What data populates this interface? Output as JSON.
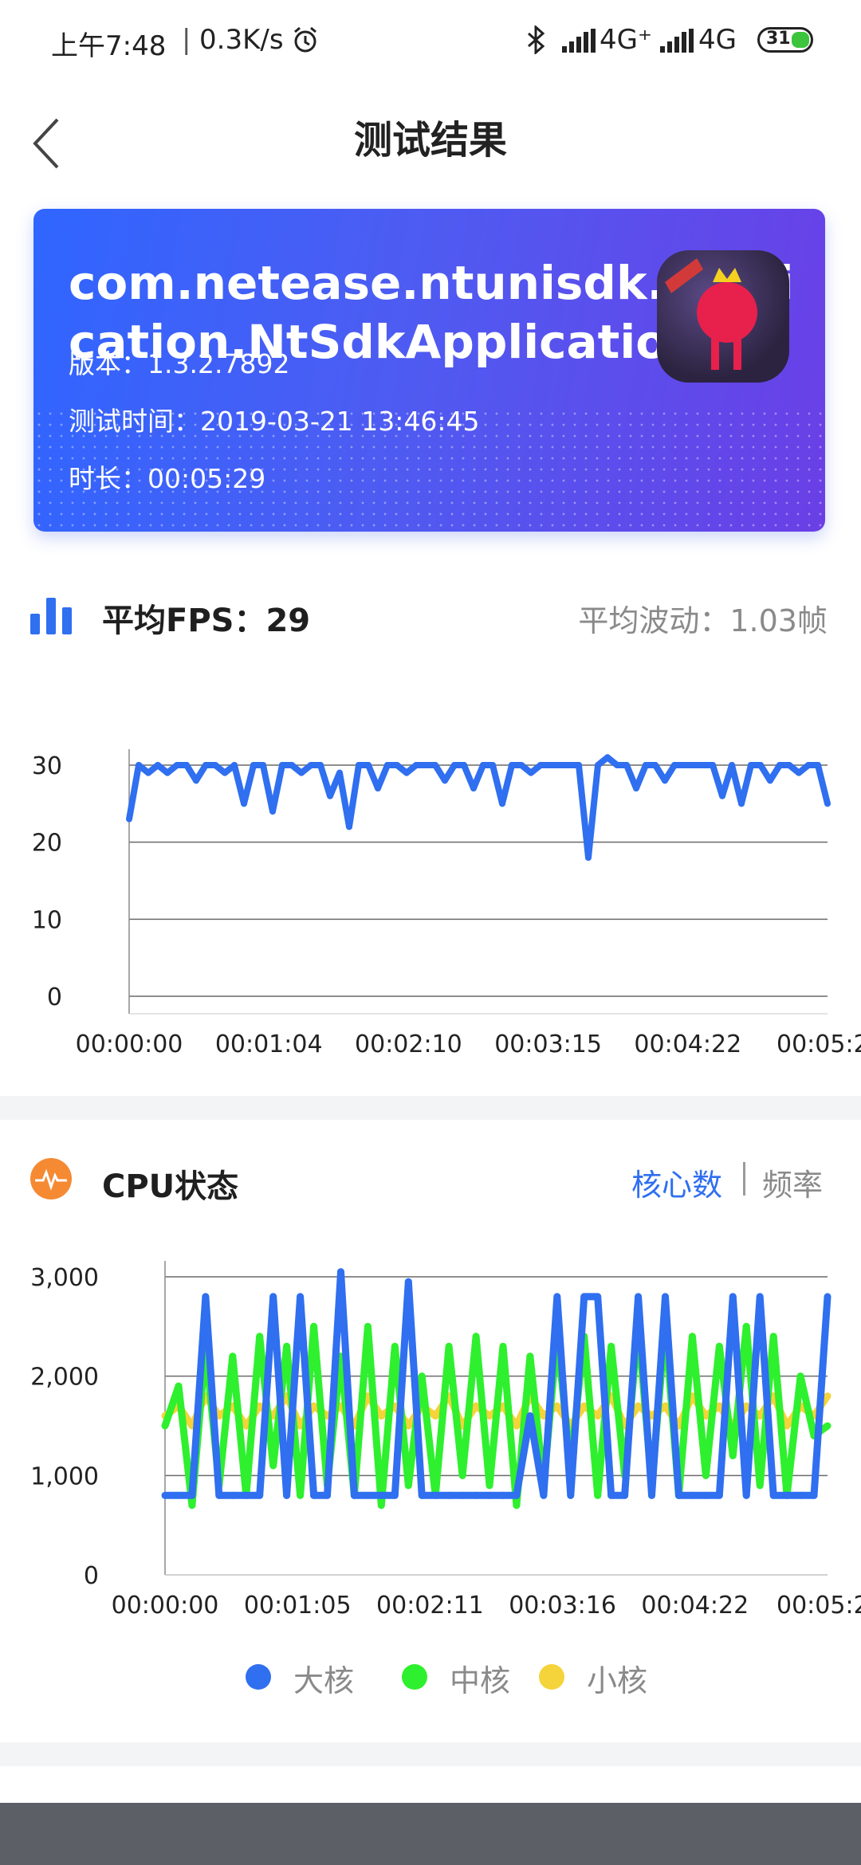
{
  "status_bar": {
    "time": "上午7:48",
    "speed": "0.3K/s",
    "net1": "4G⁺",
    "net2": "4G",
    "battery": "31"
  },
  "header": {
    "title": "测试结果"
  },
  "app_card": {
    "package": "com.netease.ntunisdk.application.NtSdkApplication",
    "version": "版本：1.3.2.7892",
    "test_time": "测试时间：2019-03-21 13:46:45",
    "duration": "时长：00:05:29"
  },
  "fps_section": {
    "title": "平均FPS：29",
    "fluctuation": "平均波动：1.03帧"
  },
  "cpu_section": {
    "title": "CPU状态",
    "tab_cores": "核心数",
    "tab_freq": "频率",
    "legend": [
      {
        "label": "大核",
        "color": "#2f6ff0"
      },
      {
        "label": "中核",
        "color": "#2ef02e"
      },
      {
        "label": "小核",
        "color": "#f5d33a"
      }
    ]
  },
  "colors": {
    "accent": "#2f6ff0",
    "orange": "#f58a33",
    "big": "#2f6ff0",
    "mid": "#2ef02e",
    "small": "#f5d33a"
  },
  "chart_data": [
    {
      "type": "line",
      "title": "平均FPS：29",
      "y_ticks": [
        "30",
        "20",
        "10",
        "0"
      ],
      "x_ticks": [
        "00:00:00",
        "00:01:04",
        "00:02:10",
        "00:03:15",
        "00:04:22",
        "00:05:2"
      ],
      "ylim": [
        0,
        30
      ],
      "series": [
        {
          "values": [
            23,
            30,
            29,
            30,
            29,
            30,
            30,
            28,
            30,
            30,
            29,
            30,
            25,
            30,
            30,
            24,
            30,
            30,
            29,
            30,
            30,
            26,
            29,
            22,
            30,
            30,
            27,
            30,
            30,
            29,
            30,
            30,
            30,
            28,
            30,
            30,
            27,
            30,
            30,
            25,
            30,
            30,
            29,
            30,
            30,
            30,
            30,
            30,
            18,
            30,
            31,
            30,
            30,
            27,
            30,
            30,
            28,
            30,
            30,
            30,
            30,
            30,
            26,
            30,
            25,
            30,
            30,
            28,
            30,
            30,
            29,
            30,
            30,
            25
          ]
        }
      ]
    },
    {
      "type": "line",
      "x_ticks": [
        "00:00:00",
        "00:01:05",
        "00:02:11",
        "00:03:16",
        "00:04:22",
        "00:05:2"
      ],
      "y_ticks": [
        "3,000",
        "2,000",
        "1,000",
        "0"
      ],
      "ylim": [
        0,
        3000
      ],
      "series": [
        {
          "name": "大核",
          "values": [
            800,
            800,
            800,
            2800,
            800,
            800,
            800,
            800,
            2800,
            800,
            2800,
            800,
            800,
            3050,
            800,
            800,
            800,
            800,
            2950,
            800,
            800,
            800,
            800,
            800,
            800,
            800,
            800,
            1600,
            800,
            2800,
            800,
            2800,
            2800,
            800,
            800,
            2800,
            800,
            2800,
            800,
            800,
            800,
            800,
            2800,
            800,
            2800,
            800,
            800,
            800,
            800,
            2800
          ]
        },
        {
          "name": "中核",
          "values": [
            1500,
            1900,
            700,
            2300,
            900,
            2200,
            800,
            2400,
            1100,
            2300,
            800,
            2500,
            900,
            2200,
            800,
            2500,
            700,
            2300,
            900,
            2000,
            800,
            2300,
            1000,
            2400,
            900,
            2300,
            700,
            2200,
            900,
            2400,
            1100,
            2400,
            800,
            2300,
            1000,
            2500,
            900,
            2500,
            800,
            2400,
            1000,
            2300,
            1200,
            2500,
            900,
            2400,
            800,
            2000,
            1400,
            1500
          ]
        },
        {
          "name": "小核",
          "values": [
            1600,
            1700,
            1500,
            1800,
            1600,
            1700,
            1500,
            1700,
            1600,
            1800,
            1500,
            1700,
            1600,
            1700,
            1500,
            1800,
            1600,
            1700,
            1500,
            1700,
            1600,
            1800,
            1500,
            1700,
            1600,
            1700,
            1500,
            1800,
            1600,
            1700,
            1500,
            1700,
            1600,
            1800,
            1500,
            1700,
            1600,
            1700,
            1500,
            1800,
            1600,
            1700,
            1500,
            1700,
            1600,
            1800,
            1500,
            1700,
            1600,
            1800
          ]
        }
      ]
    }
  ]
}
